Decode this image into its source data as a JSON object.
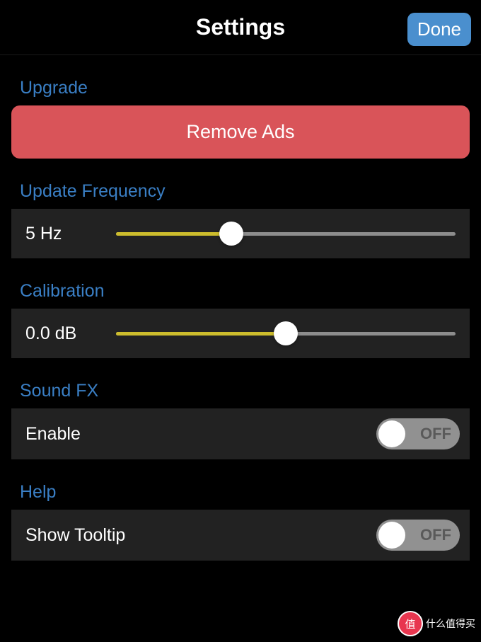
{
  "header": {
    "title": "Settings",
    "done_label": "Done"
  },
  "sections": {
    "upgrade": {
      "header": "Upgrade",
      "remove_ads_label": "Remove Ads"
    },
    "update_frequency": {
      "header": "Update Frequency",
      "value_label": "5 Hz",
      "slider_percent": 34
    },
    "calibration": {
      "header": "Calibration",
      "value_label": "0.0 dB",
      "slider_percent": 50
    },
    "sound_fx": {
      "header": "Sound FX",
      "enable_label": "Enable",
      "toggle_state": "OFF"
    },
    "help": {
      "header": "Help",
      "tooltip_label": "Show Tooltip",
      "toggle_state": "OFF"
    }
  },
  "watermark": {
    "badge_text": "值",
    "text": "什么值得买"
  }
}
